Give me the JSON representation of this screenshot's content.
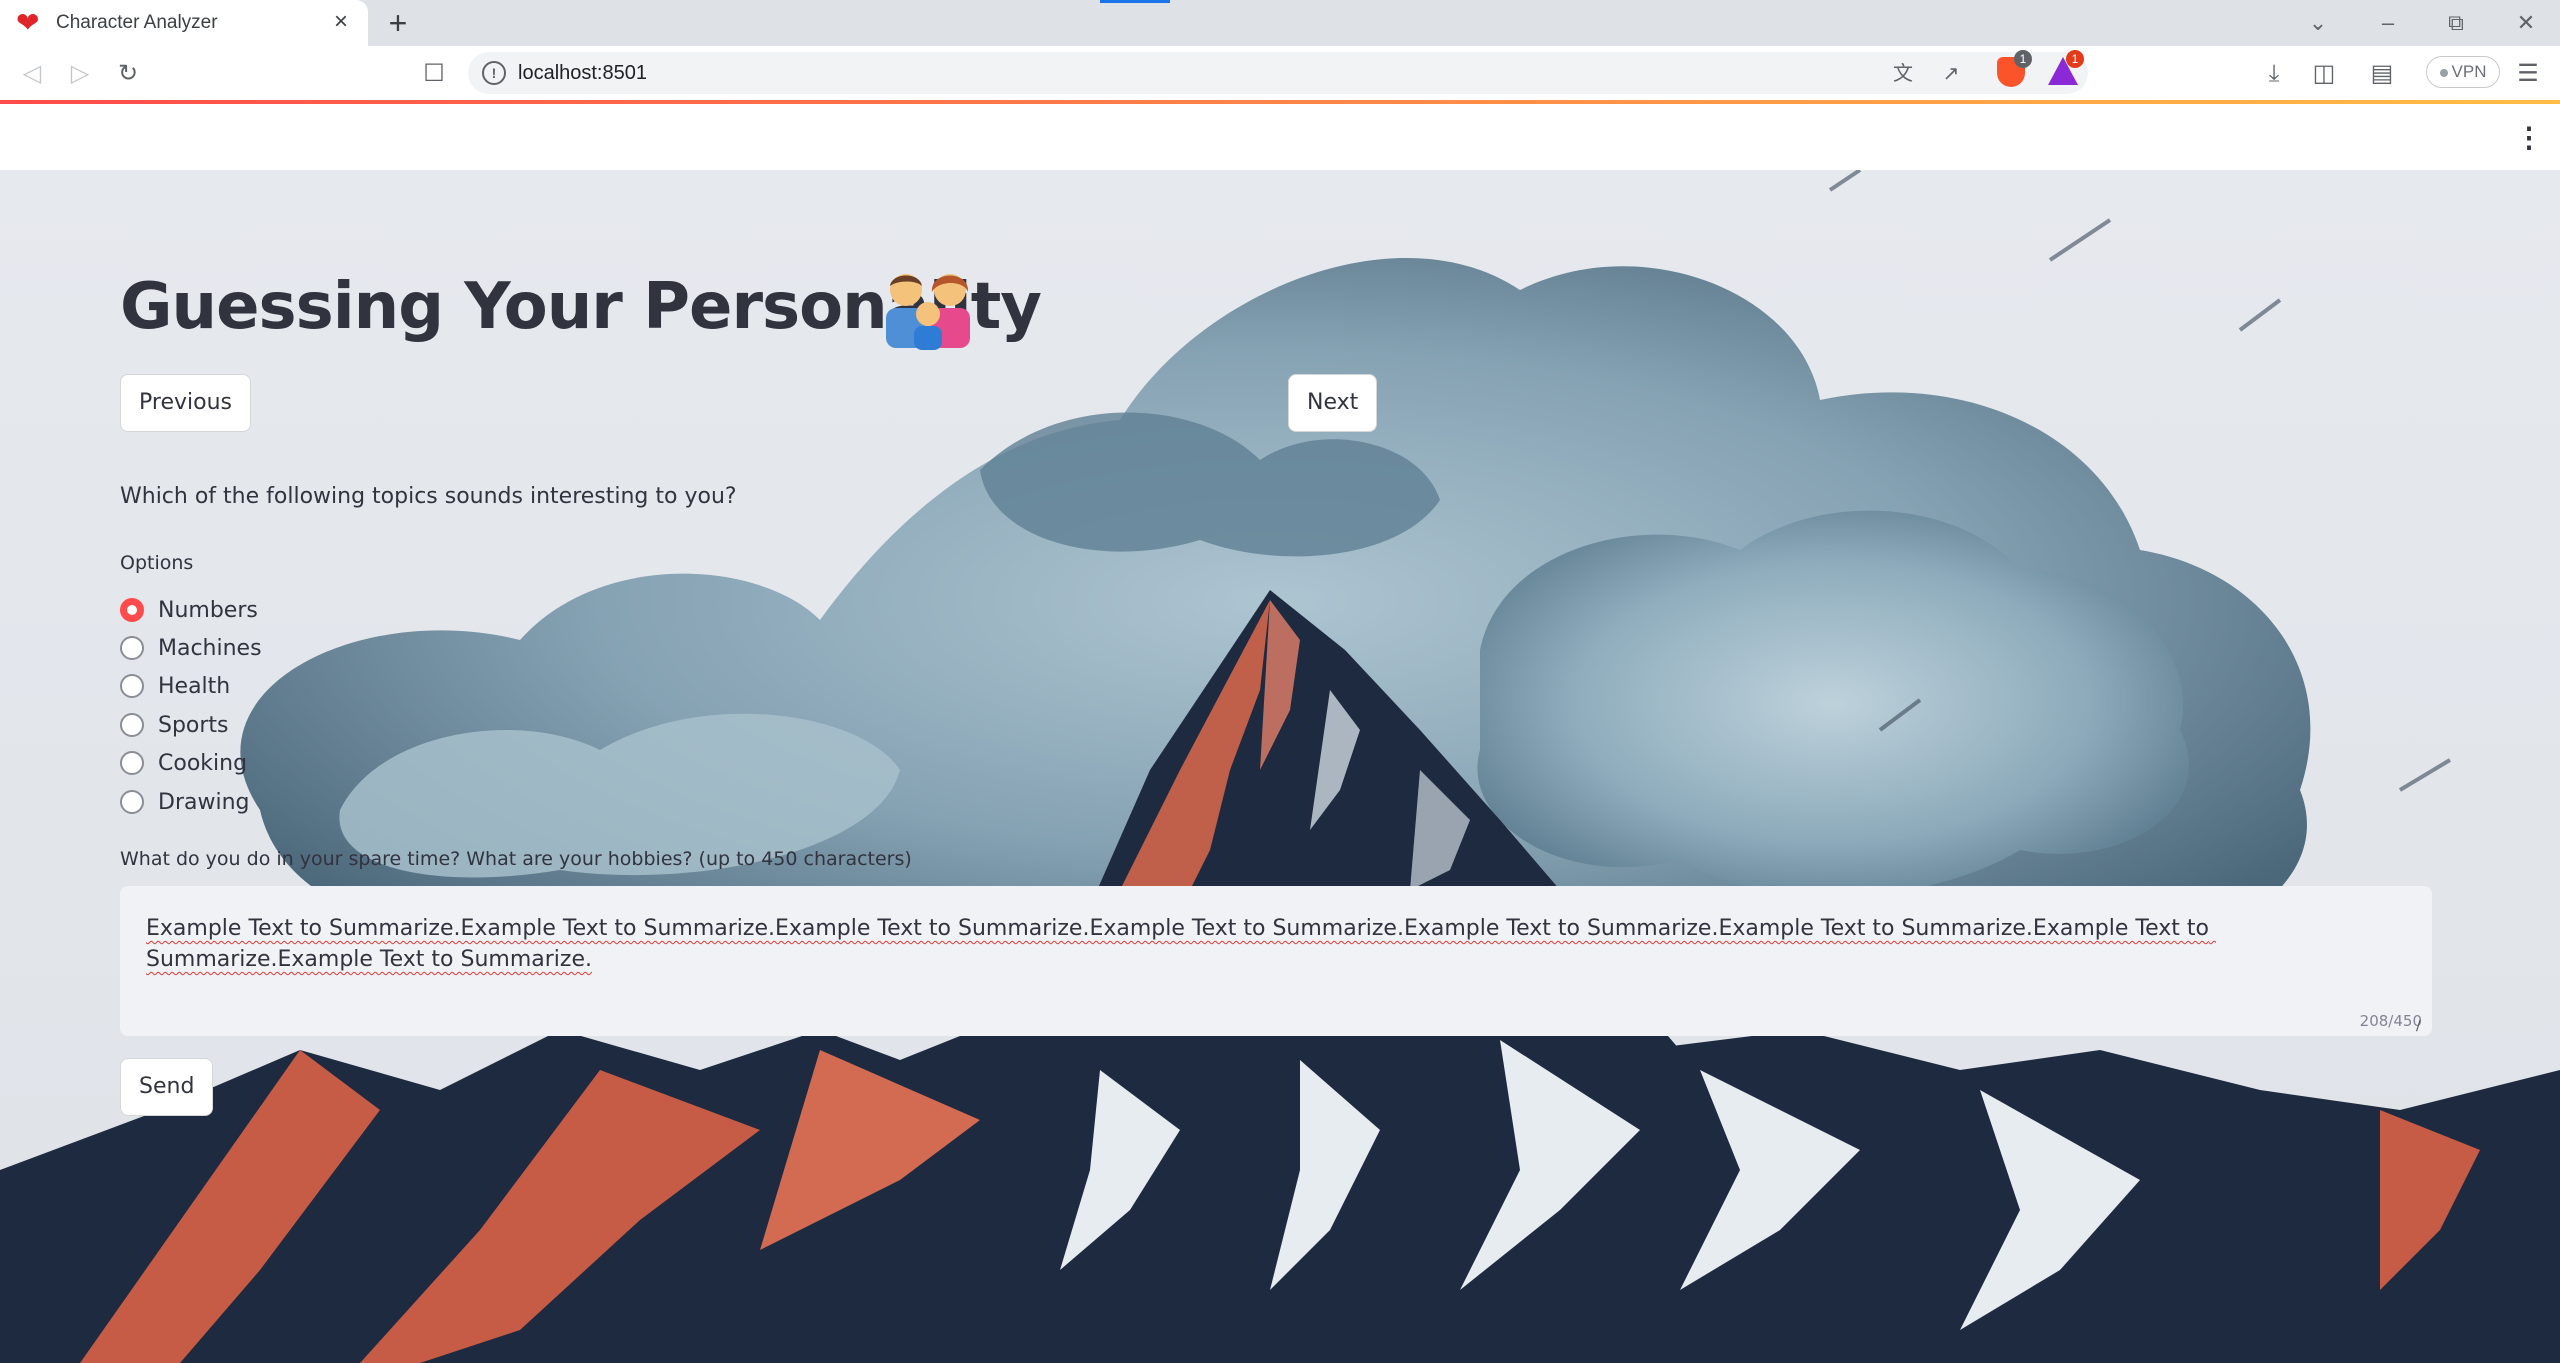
{
  "browser": {
    "tab_title": "Character Analyzer",
    "url": "localhost:8501",
    "shield_badge": "1",
    "rewards_badge": "1",
    "vpn_label": "VPN"
  },
  "page": {
    "title": "Guessing Your Personality",
    "title_emoji": "family-icon",
    "previous_label": "Previous",
    "next_label": "Next",
    "question": "Which of the following topics sounds interesting to you?",
    "options_label": "Options",
    "options": [
      {
        "label": "Numbers",
        "selected": true
      },
      {
        "label": "Machines",
        "selected": false
      },
      {
        "label": "Health",
        "selected": false
      },
      {
        "label": "Sports",
        "selected": false
      },
      {
        "label": "Cooking",
        "selected": false
      },
      {
        "label": "Drawing",
        "selected": false
      }
    ],
    "hobbies_label": "What do you do in your spare time? What are your hobbies? (up to 450 characters)",
    "hobbies_value": "Example Text to Summarize.Example Text to Summarize.Example Text to Summarize.Example Text to Summarize.Example Text to Summarize.Example Text to Summarize.Example Text to Summarize.Example Text to Summarize.",
    "char_count": "208/450",
    "send_label": "Send"
  },
  "colors": {
    "primary": "#ff4b4b",
    "text": "#31333f",
    "input_bg": "#f0f2f6"
  }
}
